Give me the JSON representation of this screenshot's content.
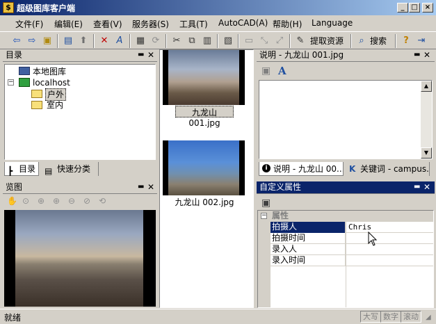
{
  "window": {
    "title": "超级图库客户端",
    "min": "_",
    "max": "□",
    "close": "×"
  },
  "menu": [
    "文件(F)",
    "编辑(E)",
    "查看(V)",
    "服务器(S)",
    "工具(T)",
    "AutoCAD(A)",
    "帮助(H)",
    "Language"
  ],
  "toolbar": {
    "extract_label": "提取资源",
    "search_label": "搜索"
  },
  "catalog": {
    "title": "目录",
    "tree": [
      "本地图库",
      "localhost",
      "户外",
      "室内"
    ],
    "tabs": [
      "目录",
      "快速分类"
    ]
  },
  "preview": {
    "title": "览图"
  },
  "thumbnails": [
    "九龙山 001.jpg",
    "九龙山 002.jpg"
  ],
  "description": {
    "title": "说明 - 九龙山 001.jpg",
    "tabs": [
      "说明 - 九龙山 00...",
      "关键词 - campus...."
    ]
  },
  "properties": {
    "title": "自定义属性",
    "group": "属性",
    "rows": [
      {
        "name": "拍摄人",
        "value": "Chris"
      },
      {
        "name": "拍摄时间",
        "value": ""
      },
      {
        "name": "录入人",
        "value": ""
      },
      {
        "name": "录入时间",
        "value": ""
      }
    ]
  },
  "status": {
    "text": "就绪",
    "indicators": [
      "大写",
      "数字",
      "滚动"
    ]
  },
  "colors": {
    "titlebar": "#0a246a",
    "selection": "#0a246a",
    "face": "#d4d0c8"
  }
}
